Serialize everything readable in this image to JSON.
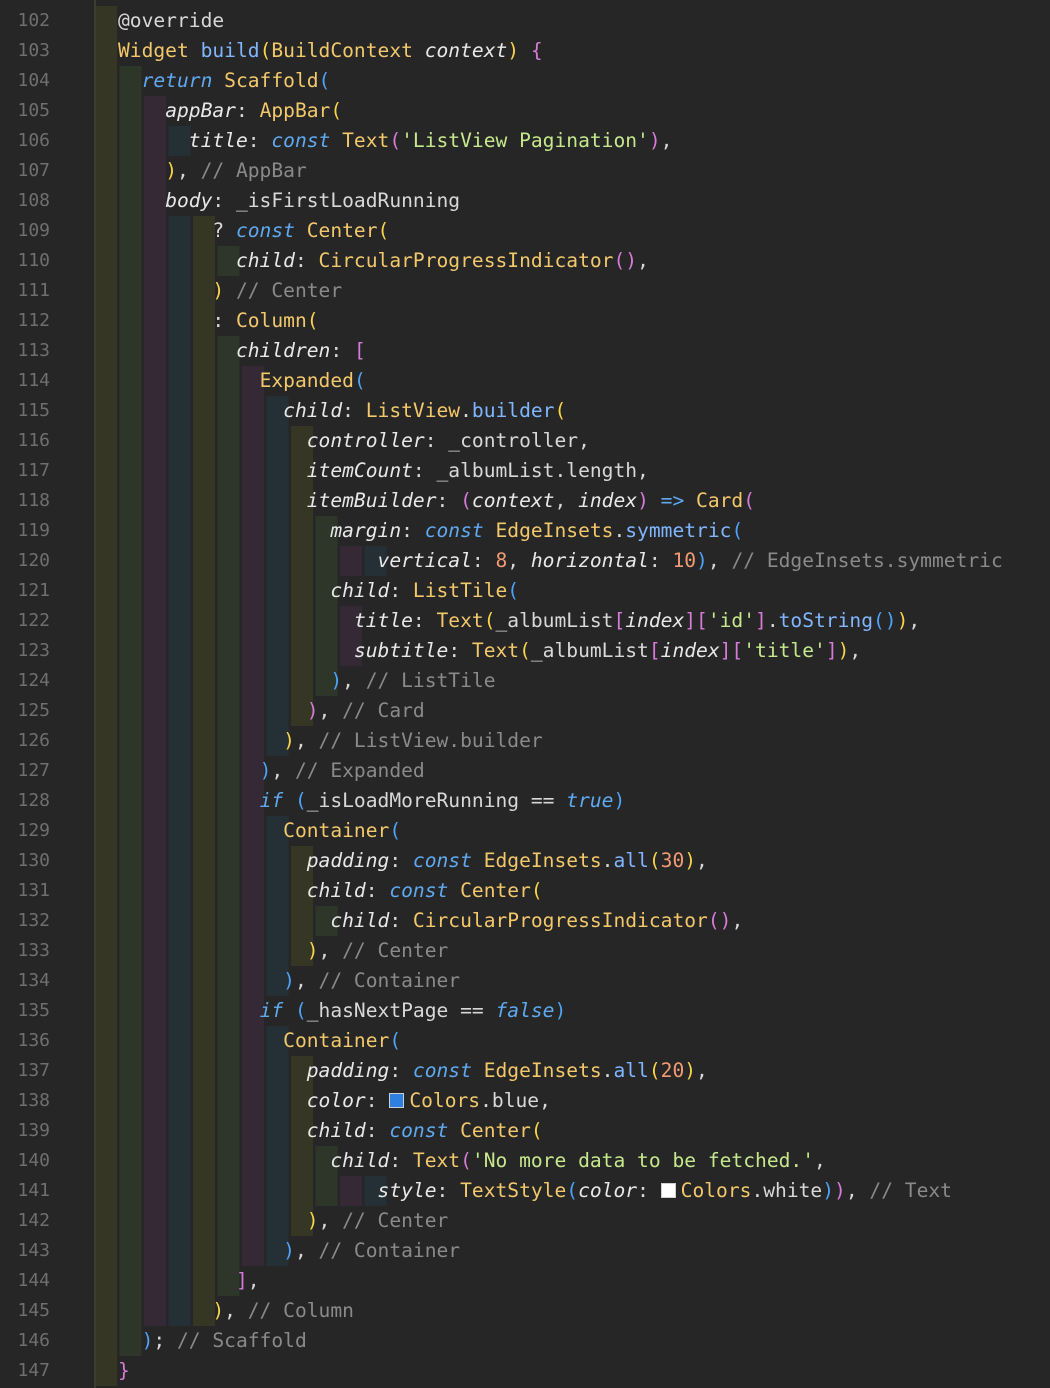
{
  "editor": {
    "language": "dart",
    "first_line_number": 102,
    "colors": {
      "background": "#262626",
      "gutter_text": "#6f6f6f",
      "text": "#d8d8d8",
      "keyword": "#5ea9f0",
      "type": "#f2c86b",
      "function": "#7fb6ff",
      "string": "#c6e88d",
      "number": "#f29b72",
      "comment": "#8a8a8a",
      "bracket_yellow": "#f7d44a",
      "bracket_magenta": "#d77bd9",
      "bracket_blue": "#4fa3f7"
    },
    "line_numbers": [
      "102",
      "103",
      "104",
      "105",
      "106",
      "107",
      "108",
      "109",
      "110",
      "111",
      "112",
      "113",
      "114",
      "115",
      "116",
      "117",
      "118",
      "119",
      "120",
      "121",
      "122",
      "123",
      "124",
      "125",
      "126",
      "127",
      "128",
      "129",
      "130",
      "131",
      "132",
      "133",
      "134",
      "135",
      "136",
      "137",
      "138",
      "139",
      "140",
      "141",
      "142",
      "143",
      "144",
      "145",
      "146",
      "147"
    ],
    "lines": [
      [
        {
          "c": "ann",
          "t": "@override"
        }
      ],
      [
        {
          "c": "ty",
          "t": "Widget"
        },
        {
          "c": "",
          "t": " "
        },
        {
          "c": "fn",
          "t": "build"
        },
        {
          "c": "by",
          "t": "("
        },
        {
          "c": "ty",
          "t": "BuildContext"
        },
        {
          "c": "",
          "t": " "
        },
        {
          "c": "it",
          "t": "context"
        },
        {
          "c": "by",
          "t": ")"
        },
        {
          "c": "",
          "t": " "
        },
        {
          "c": "bm",
          "t": "{"
        }
      ],
      [
        {
          "c": "",
          "t": "  "
        },
        {
          "c": "kw",
          "t": "return"
        },
        {
          "c": "",
          "t": " "
        },
        {
          "c": "ty",
          "t": "Scaffold"
        },
        {
          "c": "bb",
          "t": "("
        }
      ],
      [
        {
          "c": "",
          "t": "    "
        },
        {
          "c": "it",
          "t": "appBar"
        },
        {
          "c": "",
          "t": ": "
        },
        {
          "c": "ty",
          "t": "AppBar"
        },
        {
          "c": "by",
          "t": "("
        }
      ],
      [
        {
          "c": "",
          "t": "      "
        },
        {
          "c": "it",
          "t": "title"
        },
        {
          "c": "",
          "t": ": "
        },
        {
          "c": "kw",
          "t": "const"
        },
        {
          "c": "",
          "t": " "
        },
        {
          "c": "ty",
          "t": "Text"
        },
        {
          "c": "bm",
          "t": "("
        },
        {
          "c": "st",
          "t": "'ListView Pagination'"
        },
        {
          "c": "bm",
          "t": ")"
        },
        {
          "c": "",
          "t": ","
        }
      ],
      [
        {
          "c": "",
          "t": "    "
        },
        {
          "c": "by",
          "t": ")"
        },
        {
          "c": "",
          "t": ", "
        },
        {
          "c": "cm",
          "t": "// AppBar"
        }
      ],
      [
        {
          "c": "",
          "t": "    "
        },
        {
          "c": "it",
          "t": "body"
        },
        {
          "c": "",
          "t": ": _isFirstLoadRunning"
        }
      ],
      [
        {
          "c": "",
          "t": "        ? "
        },
        {
          "c": "kw",
          "t": "const"
        },
        {
          "c": "",
          "t": " "
        },
        {
          "c": "ty",
          "t": "Center"
        },
        {
          "c": "by",
          "t": "("
        }
      ],
      [
        {
          "c": "",
          "t": "          "
        },
        {
          "c": "it",
          "t": "child"
        },
        {
          "c": "",
          "t": ": "
        },
        {
          "c": "ty",
          "t": "CircularProgressIndicator"
        },
        {
          "c": "bm",
          "t": "()"
        },
        {
          "c": "",
          "t": ","
        }
      ],
      [
        {
          "c": "",
          "t": "        "
        },
        {
          "c": "by",
          "t": ")"
        },
        {
          "c": "",
          "t": " "
        },
        {
          "c": "cm",
          "t": "// Center"
        }
      ],
      [
        {
          "c": "",
          "t": "        : "
        },
        {
          "c": "ty",
          "t": "Column"
        },
        {
          "c": "by",
          "t": "("
        }
      ],
      [
        {
          "c": "",
          "t": "          "
        },
        {
          "c": "it",
          "t": "children"
        },
        {
          "c": "",
          "t": ": "
        },
        {
          "c": "bm",
          "t": "["
        }
      ],
      [
        {
          "c": "",
          "t": "            "
        },
        {
          "c": "ty",
          "t": "Expanded"
        },
        {
          "c": "bb",
          "t": "("
        }
      ],
      [
        {
          "c": "",
          "t": "              "
        },
        {
          "c": "it",
          "t": "child"
        },
        {
          "c": "",
          "t": ": "
        },
        {
          "c": "ty",
          "t": "ListView"
        },
        {
          "c": "",
          "t": "."
        },
        {
          "c": "fn",
          "t": "builder"
        },
        {
          "c": "by",
          "t": "("
        }
      ],
      [
        {
          "c": "",
          "t": "                "
        },
        {
          "c": "it",
          "t": "controller"
        },
        {
          "c": "",
          "t": ": _controller,"
        }
      ],
      [
        {
          "c": "",
          "t": "                "
        },
        {
          "c": "it",
          "t": "itemCount"
        },
        {
          "c": "",
          "t": ": _albumList.length,"
        }
      ],
      [
        {
          "c": "",
          "t": "                "
        },
        {
          "c": "it",
          "t": "itemBuilder"
        },
        {
          "c": "",
          "t": ": "
        },
        {
          "c": "bm",
          "t": "("
        },
        {
          "c": "it",
          "t": "context"
        },
        {
          "c": "",
          "t": ", "
        },
        {
          "c": "it",
          "t": "index"
        },
        {
          "c": "bm",
          "t": ")"
        },
        {
          "c": "",
          "t": " "
        },
        {
          "c": "kw",
          "t": "=>"
        },
        {
          "c": "",
          "t": " "
        },
        {
          "c": "ty",
          "t": "Card"
        },
        {
          "c": "bm",
          "t": "("
        }
      ],
      [
        {
          "c": "",
          "t": "                  "
        },
        {
          "c": "it",
          "t": "margin"
        },
        {
          "c": "",
          "t": ": "
        },
        {
          "c": "kw",
          "t": "const"
        },
        {
          "c": "",
          "t": " "
        },
        {
          "c": "ty",
          "t": "EdgeInsets"
        },
        {
          "c": "",
          "t": "."
        },
        {
          "c": "fn",
          "t": "symmetric"
        },
        {
          "c": "bb",
          "t": "("
        }
      ],
      [
        {
          "c": "",
          "t": "                      "
        },
        {
          "c": "it",
          "t": "vertical"
        },
        {
          "c": "",
          "t": ": "
        },
        {
          "c": "nu",
          "t": "8"
        },
        {
          "c": "",
          "t": ", "
        },
        {
          "c": "it",
          "t": "horizontal"
        },
        {
          "c": "",
          "t": ": "
        },
        {
          "c": "nu",
          "t": "10"
        },
        {
          "c": "bb",
          "t": ")"
        },
        {
          "c": "",
          "t": ", "
        },
        {
          "c": "cm",
          "t": "// EdgeInsets.symmetric"
        }
      ],
      [
        {
          "c": "",
          "t": "                  "
        },
        {
          "c": "it",
          "t": "child"
        },
        {
          "c": "",
          "t": ": "
        },
        {
          "c": "ty",
          "t": "ListTile"
        },
        {
          "c": "bb",
          "t": "("
        }
      ],
      [
        {
          "c": "",
          "t": "                    "
        },
        {
          "c": "it",
          "t": "title"
        },
        {
          "c": "",
          "t": ": "
        },
        {
          "c": "ty",
          "t": "Text"
        },
        {
          "c": "by",
          "t": "("
        },
        {
          "c": "",
          "t": "_albumList"
        },
        {
          "c": "bm",
          "t": "["
        },
        {
          "c": "it",
          "t": "index"
        },
        {
          "c": "bm",
          "t": "]["
        },
        {
          "c": "st",
          "t": "'id'"
        },
        {
          "c": "bm",
          "t": "]"
        },
        {
          "c": "",
          "t": "."
        },
        {
          "c": "fn",
          "t": "toString"
        },
        {
          "c": "bb",
          "t": "()"
        },
        {
          "c": "by",
          "t": ")"
        },
        {
          "c": "",
          "t": ","
        }
      ],
      [
        {
          "c": "",
          "t": "                    "
        },
        {
          "c": "it",
          "t": "subtitle"
        },
        {
          "c": "",
          "t": ": "
        },
        {
          "c": "ty",
          "t": "Text"
        },
        {
          "c": "by",
          "t": "("
        },
        {
          "c": "",
          "t": "_albumList"
        },
        {
          "c": "bm",
          "t": "["
        },
        {
          "c": "it",
          "t": "index"
        },
        {
          "c": "bm",
          "t": "]["
        },
        {
          "c": "st",
          "t": "'title'"
        },
        {
          "c": "bm",
          "t": "]"
        },
        {
          "c": "by",
          "t": ")"
        },
        {
          "c": "",
          "t": ","
        }
      ],
      [
        {
          "c": "",
          "t": "                  "
        },
        {
          "c": "bb",
          "t": ")"
        },
        {
          "c": "",
          "t": ", "
        },
        {
          "c": "cm",
          "t": "// ListTile"
        }
      ],
      [
        {
          "c": "",
          "t": "                "
        },
        {
          "c": "bm",
          "t": ")"
        },
        {
          "c": "",
          "t": ", "
        },
        {
          "c": "cm",
          "t": "// Card"
        }
      ],
      [
        {
          "c": "",
          "t": "              "
        },
        {
          "c": "by",
          "t": ")"
        },
        {
          "c": "",
          "t": ", "
        },
        {
          "c": "cm",
          "t": "// ListView.builder"
        }
      ],
      [
        {
          "c": "",
          "t": "            "
        },
        {
          "c": "bb",
          "t": ")"
        },
        {
          "c": "",
          "t": ", "
        },
        {
          "c": "cm",
          "t": "// Expanded"
        }
      ],
      [
        {
          "c": "",
          "t": "            "
        },
        {
          "c": "kw",
          "t": "if"
        },
        {
          "c": "",
          "t": " "
        },
        {
          "c": "bb",
          "t": "("
        },
        {
          "c": "",
          "t": "_isLoadMoreRunning == "
        },
        {
          "c": "kw",
          "t": "true"
        },
        {
          "c": "bb",
          "t": ")"
        }
      ],
      [
        {
          "c": "",
          "t": "              "
        },
        {
          "c": "ty",
          "t": "Container"
        },
        {
          "c": "bb",
          "t": "("
        }
      ],
      [
        {
          "c": "",
          "t": "                "
        },
        {
          "c": "it",
          "t": "padding"
        },
        {
          "c": "",
          "t": ": "
        },
        {
          "c": "kw",
          "t": "const"
        },
        {
          "c": "",
          "t": " "
        },
        {
          "c": "ty",
          "t": "EdgeInsets"
        },
        {
          "c": "",
          "t": "."
        },
        {
          "c": "fn",
          "t": "all"
        },
        {
          "c": "by",
          "t": "("
        },
        {
          "c": "nu",
          "t": "30"
        },
        {
          "c": "by",
          "t": ")"
        },
        {
          "c": "",
          "t": ","
        }
      ],
      [
        {
          "c": "",
          "t": "                "
        },
        {
          "c": "it",
          "t": "child"
        },
        {
          "c": "",
          "t": ": "
        },
        {
          "c": "kw",
          "t": "const"
        },
        {
          "c": "",
          "t": " "
        },
        {
          "c": "ty",
          "t": "Center"
        },
        {
          "c": "by",
          "t": "("
        }
      ],
      [
        {
          "c": "",
          "t": "                  "
        },
        {
          "c": "it",
          "t": "child"
        },
        {
          "c": "",
          "t": ": "
        },
        {
          "c": "ty",
          "t": "CircularProgressIndicator"
        },
        {
          "c": "bm",
          "t": "()"
        },
        {
          "c": "",
          "t": ","
        }
      ],
      [
        {
          "c": "",
          "t": "                "
        },
        {
          "c": "by",
          "t": ")"
        },
        {
          "c": "",
          "t": ", "
        },
        {
          "c": "cm",
          "t": "// Center"
        }
      ],
      [
        {
          "c": "",
          "t": "              "
        },
        {
          "c": "bb",
          "t": ")"
        },
        {
          "c": "",
          "t": ", "
        },
        {
          "c": "cm",
          "t": "// Container"
        }
      ],
      [
        {
          "c": "",
          "t": "            "
        },
        {
          "c": "kw",
          "t": "if"
        },
        {
          "c": "",
          "t": " "
        },
        {
          "c": "bb",
          "t": "("
        },
        {
          "c": "",
          "t": "_hasNextPage == "
        },
        {
          "c": "kw",
          "t": "false"
        },
        {
          "c": "bb",
          "t": ")"
        }
      ],
      [
        {
          "c": "",
          "t": "              "
        },
        {
          "c": "ty",
          "t": "Container"
        },
        {
          "c": "bb",
          "t": "("
        }
      ],
      [
        {
          "c": "",
          "t": "                "
        },
        {
          "c": "it",
          "t": "padding"
        },
        {
          "c": "",
          "t": ": "
        },
        {
          "c": "kw",
          "t": "const"
        },
        {
          "c": "",
          "t": " "
        },
        {
          "c": "ty",
          "t": "EdgeInsets"
        },
        {
          "c": "",
          "t": "."
        },
        {
          "c": "fn",
          "t": "all"
        },
        {
          "c": "by",
          "t": "("
        },
        {
          "c": "nu",
          "t": "20"
        },
        {
          "c": "by",
          "t": ")"
        },
        {
          "c": "",
          "t": ","
        }
      ],
      [
        {
          "c": "",
          "t": "                "
        },
        {
          "c": "it",
          "t": "color"
        },
        {
          "c": "",
          "t": ": "
        },
        {
          "c": "swatch",
          "t": "#2f7fe0"
        },
        {
          "c": "ty",
          "t": "Colors"
        },
        {
          "c": "",
          "t": ".blue,"
        }
      ],
      [
        {
          "c": "",
          "t": "                "
        },
        {
          "c": "it",
          "t": "child"
        },
        {
          "c": "",
          "t": ": "
        },
        {
          "c": "kw",
          "t": "const"
        },
        {
          "c": "",
          "t": " "
        },
        {
          "c": "ty",
          "t": "Center"
        },
        {
          "c": "by",
          "t": "("
        }
      ],
      [
        {
          "c": "",
          "t": "                  "
        },
        {
          "c": "it",
          "t": "child"
        },
        {
          "c": "",
          "t": ": "
        },
        {
          "c": "ty",
          "t": "Text"
        },
        {
          "c": "bm",
          "t": "("
        },
        {
          "c": "st",
          "t": "'No more data to be fetched.'"
        },
        {
          "c": "",
          "t": ","
        }
      ],
      [
        {
          "c": "",
          "t": "                      "
        },
        {
          "c": "it",
          "t": "style"
        },
        {
          "c": "",
          "t": ": "
        },
        {
          "c": "ty",
          "t": "TextStyle"
        },
        {
          "c": "bb",
          "t": "("
        },
        {
          "c": "it",
          "t": "color"
        },
        {
          "c": "",
          "t": ": "
        },
        {
          "c": "swatch",
          "t": "#ffffff"
        },
        {
          "c": "ty",
          "t": "Colors"
        },
        {
          "c": "",
          "t": ".white"
        },
        {
          "c": "bb",
          "t": ")"
        },
        {
          "c": "bm",
          "t": ")"
        },
        {
          "c": "",
          "t": ", "
        },
        {
          "c": "cm",
          "t": "// Text"
        }
      ],
      [
        {
          "c": "",
          "t": "                "
        },
        {
          "c": "by",
          "t": ")"
        },
        {
          "c": "",
          "t": ", "
        },
        {
          "c": "cm",
          "t": "// Center"
        }
      ],
      [
        {
          "c": "",
          "t": "              "
        },
        {
          "c": "bb",
          "t": ")"
        },
        {
          "c": "",
          "t": ", "
        },
        {
          "c": "cm",
          "t": "// Container"
        }
      ],
      [
        {
          "c": "",
          "t": "          "
        },
        {
          "c": "bm",
          "t": "]"
        },
        {
          "c": "",
          "t": ","
        }
      ],
      [
        {
          "c": "",
          "t": "        "
        },
        {
          "c": "by",
          "t": ")"
        },
        {
          "c": "",
          "t": ", "
        },
        {
          "c": "cm",
          "t": "// Column"
        }
      ],
      [
        {
          "c": "",
          "t": "  "
        },
        {
          "c": "bb",
          "t": ")"
        },
        {
          "c": "",
          "t": "; "
        },
        {
          "c": "cm",
          "t": "// Scaffold"
        }
      ],
      [
        {
          "c": "bm",
          "t": "}"
        }
      ]
    ]
  }
}
